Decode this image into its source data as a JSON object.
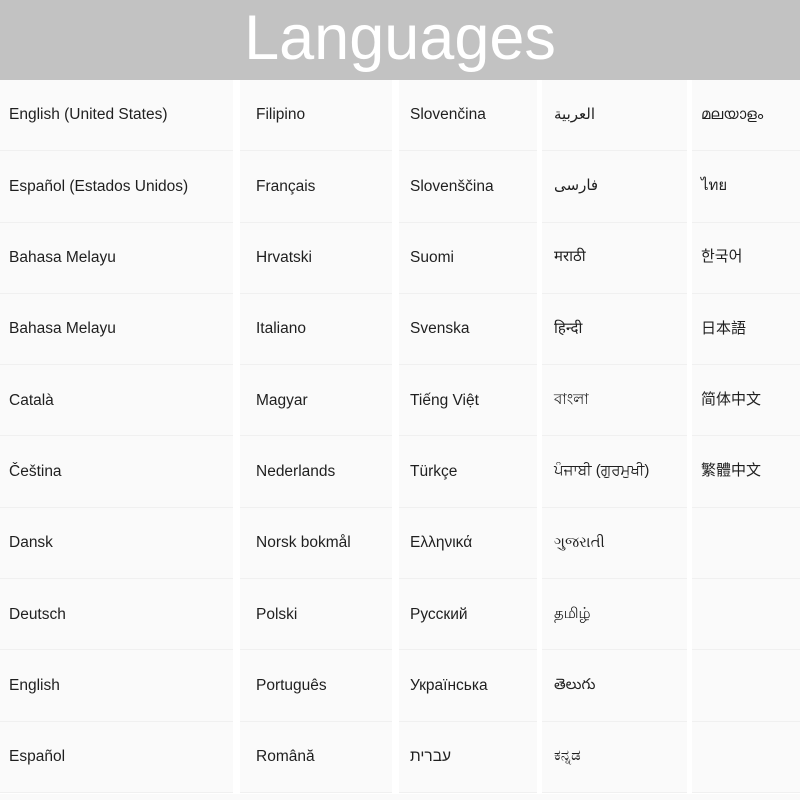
{
  "header": {
    "title": "Languages",
    "background_color": "#c2c2c2",
    "text_color": "#ffffff"
  },
  "grid": {
    "rows": 10,
    "columns": 5,
    "cell_background": "#fafafa",
    "separator_color": "#ffffff",
    "text_color": "#1f1f1f"
  },
  "columns": [
    {
      "index": 1,
      "items": [
        "English (United States)",
        "Español (Estados Unidos)",
        "Bahasa Melayu",
        "Bahasa Melayu",
        "Català",
        "Čeština",
        "Dansk",
        "Deutsch",
        "English",
        "Español"
      ]
    },
    {
      "index": 2,
      "items": [
        "Filipino",
        "Français",
        "Hrvatski",
        "Italiano",
        "Magyar",
        "Nederlands",
        "Norsk bokmål",
        "Polski",
        "Português",
        "Română"
      ]
    },
    {
      "index": 3,
      "items": [
        "Slovenčina",
        "Slovenščina",
        "Suomi",
        "Svenska",
        "Tiếng Việt",
        "Türkçe",
        "Ελληνικά",
        "Русский",
        "Українська",
        "עברית"
      ]
    },
    {
      "index": 4,
      "items": [
        "العربية",
        "فارسی",
        "मराठी",
        "हिन्दी",
        "বাংলা",
        "ਪੰਜਾਬੀ (ਗੁਰਮੁਖੀ)",
        "ગુજરાતી",
        "தமிழ்",
        "తెలుగు",
        "ಕನ್ನಡ"
      ]
    },
    {
      "index": 5,
      "items": [
        "മലയാളം",
        "ไทย",
        "한국어",
        "日本語",
        "简体中文",
        "繁體中文",
        "",
        "",
        "",
        ""
      ]
    }
  ]
}
